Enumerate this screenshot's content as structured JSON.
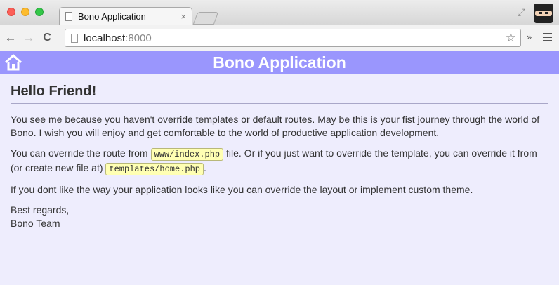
{
  "browser": {
    "tab_title": "Bono Application",
    "tab_close": "×",
    "url_host": "localhost",
    "url_port": ":8000",
    "nav": {
      "back": "←",
      "forward": "→",
      "reload": "C"
    },
    "star": "☆",
    "extensions": "»",
    "resize": "⤢"
  },
  "app": {
    "title": "Bono Application",
    "header_color": "#9a96fd",
    "background_color": "#eeedfd"
  },
  "page": {
    "heading": "Hello Friend!",
    "intro": "You see me because you haven't override templates or default routes. May be this is your fist journey through the world of Bono. I wish you will enjoy and get comfortable to the world of productive application development.",
    "override_part1": "You can override the route from ",
    "route_file": "www/index.php",
    "override_part2": " file. Or if you just want to override the template, you can override it from (or create new file at) ",
    "template_file": "templates/home.php",
    "override_part3": ".",
    "layout_text": "If you dont like the way your application looks like you can override the layout or implement custom theme.",
    "regards": "Best regards,",
    "signature": "Bono Team"
  }
}
